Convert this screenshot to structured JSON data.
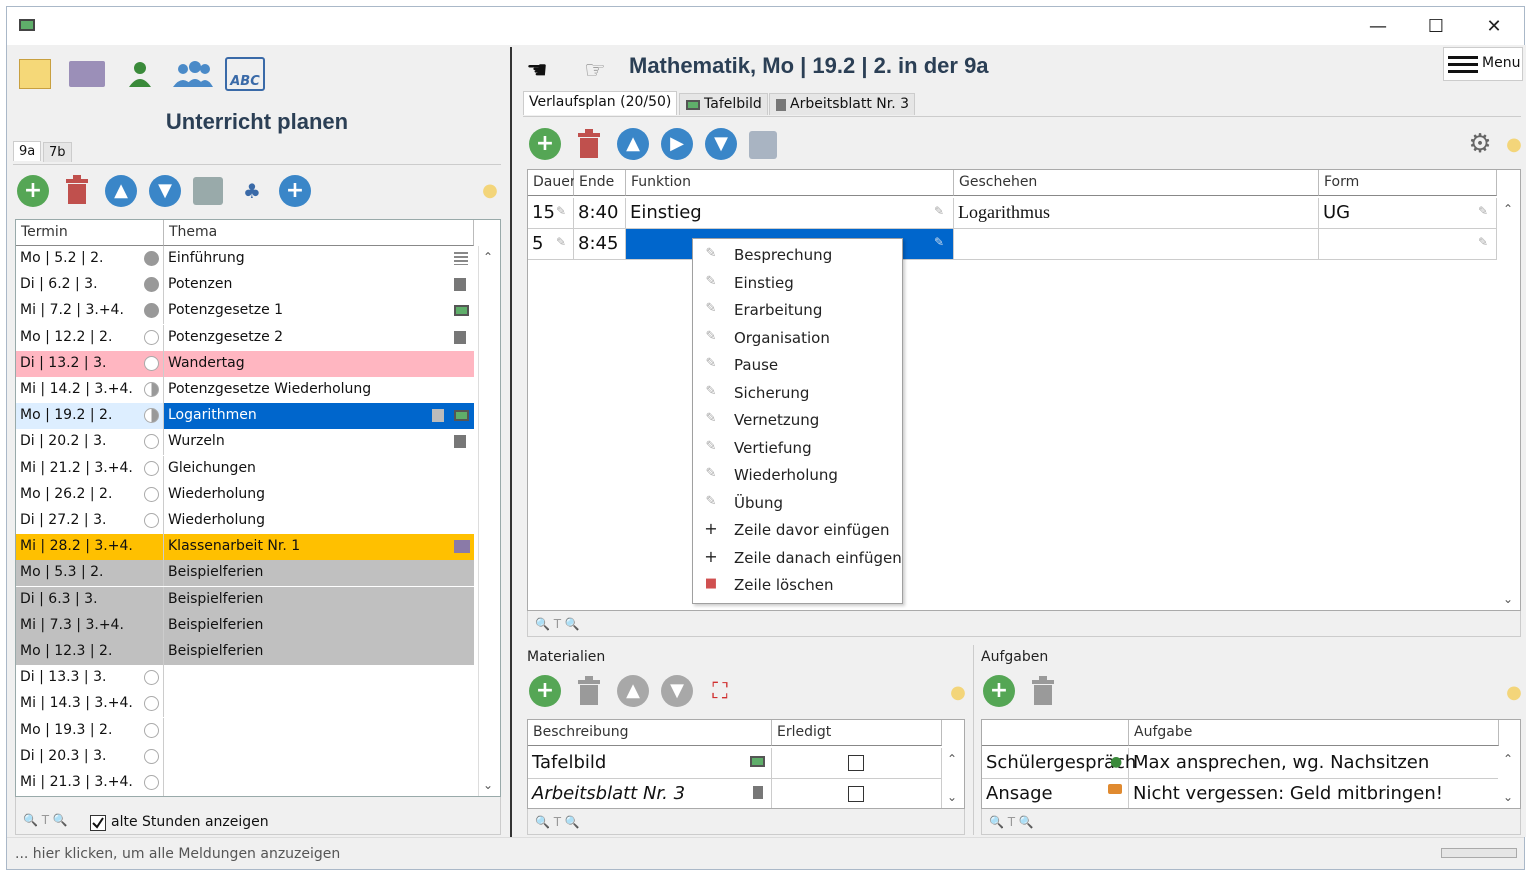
{
  "window": {
    "minimize": "—",
    "maximize": "☐",
    "close": "✕"
  },
  "left": {
    "title": "Unterricht planen",
    "tabs": [
      "9a",
      "7b"
    ],
    "columns": [
      "Termin",
      "Thema"
    ],
    "rows": [
      {
        "termin": "Mo | 5.2 | 2.",
        "thema": "Einführung",
        "bg": "#ffffff",
        "dot": "full",
        "icon": "list"
      },
      {
        "termin": "Di | 6.2 | 3.",
        "thema": "Potenzen",
        "bg": "#ffffff",
        "dot": "full",
        "icon": "doc"
      },
      {
        "termin": "Mi | 7.2 | 3.+4.",
        "thema": "Potenzgesetze 1",
        "bg": "#ffffff",
        "dot": "full",
        "icon": "board"
      },
      {
        "termin": "Mo | 12.2 | 2.",
        "thema": "Potenzgesetze 2",
        "bg": "#ffffff",
        "dot": "empty",
        "icon": "doc"
      },
      {
        "termin": "Di | 13.2 | 3.",
        "thema": "Wandertag",
        "bg": "#ffb6c1",
        "dot": "empty",
        "icon": ""
      },
      {
        "termin": "Mi | 14.2 | 3.+4.",
        "thema": "Potenzgesetze Wiederholung",
        "bg": "#ffffff",
        "dot": "half",
        "icon": ""
      },
      {
        "termin": "Mo | 19.2 | 2.",
        "thema": "Logarithmen",
        "bg": "#ddeeff",
        "bg2": "#0066cc",
        "dot": "half",
        "icon": "doc+board"
      },
      {
        "termin": "Di | 20.2 | 3.",
        "thema": "Wurzeln",
        "bg": "#ffffff",
        "dot": "empty",
        "icon": "doc"
      },
      {
        "termin": "Mi | 21.2 | 3.+4.",
        "thema": "Gleichungen",
        "bg": "#ffffff",
        "dot": "empty",
        "icon": ""
      },
      {
        "termin": "Mo | 26.2 | 2.",
        "thema": "Wiederholung",
        "bg": "#ffffff",
        "dot": "empty",
        "icon": ""
      },
      {
        "termin": "Di | 27.2 | 3.",
        "thema": "Wiederholung",
        "bg": "#ffffff",
        "dot": "empty",
        "icon": ""
      },
      {
        "termin": "Mi | 28.2 | 3.+4.",
        "thema": "Klassenarbeit Nr. 1",
        "bg": "#ffc000",
        "dot": "none",
        "icon": "test"
      },
      {
        "termin": "Mo | 5.3 | 2.",
        "thema": "Beispielferien",
        "bg": "#c0c0c0",
        "dot": "none",
        "icon": ""
      },
      {
        "termin": "Di | 6.3 | 3.",
        "thema": "Beispielferien",
        "bg": "#c0c0c0",
        "dot": "none",
        "icon": ""
      },
      {
        "termin": "Mi | 7.3 | 3.+4.",
        "thema": "Beispielferien",
        "bg": "#c0c0c0",
        "dot": "none",
        "icon": ""
      },
      {
        "termin": "Mo | 12.3 | 2.",
        "thema": "Beispielferien",
        "bg": "#c0c0c0",
        "dot": "none",
        "icon": ""
      },
      {
        "termin": "Di | 13.3 | 3.",
        "thema": "",
        "bg": "#ffffff",
        "dot": "empty",
        "icon": ""
      },
      {
        "termin": "Mi | 14.3 | 3.+4.",
        "thema": "",
        "bg": "#ffffff",
        "dot": "empty",
        "icon": ""
      },
      {
        "termin": "Mo | 19.3 | 2.",
        "thema": "",
        "bg": "#ffffff",
        "dot": "empty",
        "icon": ""
      },
      {
        "termin": "Di | 20.3 | 3.",
        "thema": "",
        "bg": "#ffffff",
        "dot": "empty",
        "icon": ""
      },
      {
        "termin": "Mi | 21.3 | 3.+4.",
        "thema": "",
        "bg": "#ffffff",
        "dot": "empty",
        "icon": ""
      }
    ],
    "footer_checkbox": "alte Stunden anzeigen"
  },
  "right": {
    "title": "Mathematik, Mo  |  19.2  |  2. in der 9a",
    "menu": "Menu",
    "tabs": [
      "Verlaufsplan (20/50)",
      "Tafelbild",
      "Arbeitsblatt Nr. 3"
    ],
    "columns": [
      "Dauer",
      "Ende",
      "Funktion",
      "Geschehen",
      "Form"
    ],
    "rows": [
      {
        "dauer": "15",
        "ende": "8:40",
        "funktion": "Einstieg",
        "geschehen": "Logarithmus",
        "form": "UG"
      },
      {
        "dauer": "5",
        "ende": "8:45",
        "funktion": "",
        "geschehen": "",
        "form": ""
      }
    ],
    "context_menu": [
      {
        "icon": "pencil",
        "label": "Besprechung"
      },
      {
        "icon": "pencil",
        "label": "Einstieg"
      },
      {
        "icon": "pencil",
        "label": "Erarbeitung"
      },
      {
        "icon": "pencil",
        "label": "Organisation"
      },
      {
        "icon": "pencil",
        "label": "Pause"
      },
      {
        "icon": "pencil",
        "label": "Sicherung"
      },
      {
        "icon": "pencil",
        "label": "Vernetzung"
      },
      {
        "icon": "pencil",
        "label": "Vertiefung"
      },
      {
        "icon": "pencil",
        "label": "Wiederholung"
      },
      {
        "icon": "pencil",
        "label": "Übung"
      },
      {
        "icon": "plus",
        "label": "Zeile davor einfügen"
      },
      {
        "icon": "plus",
        "label": "Zeile danach einfügen"
      },
      {
        "icon": "trash",
        "label": "Zeile löschen"
      }
    ],
    "materialien": {
      "label": "Materialien",
      "columns": [
        "Beschreibung",
        "Erledigt"
      ],
      "rows": [
        {
          "beschreibung": "Tafelbild",
          "erledigt": false
        },
        {
          "beschreibung": "Arbeitsblatt Nr. 3",
          "erledigt": false
        }
      ]
    },
    "aufgaben": {
      "label": "Aufgaben",
      "columns": [
        "",
        "Aufgabe"
      ],
      "rows": [
        {
          "typ": "Schülergespräch",
          "aufgabe": "Max ansprechen, wg. Nachsitzen"
        },
        {
          "typ": "Ansage",
          "aufgabe": "Nicht vergessen: Geld mitbringen!"
        }
      ]
    }
  },
  "status": "... hier klicken, um alle Meldungen anzuzeigen",
  "colors": {
    "accent": "#0066cc",
    "green": "#55a655",
    "title": "#2b3f55"
  }
}
